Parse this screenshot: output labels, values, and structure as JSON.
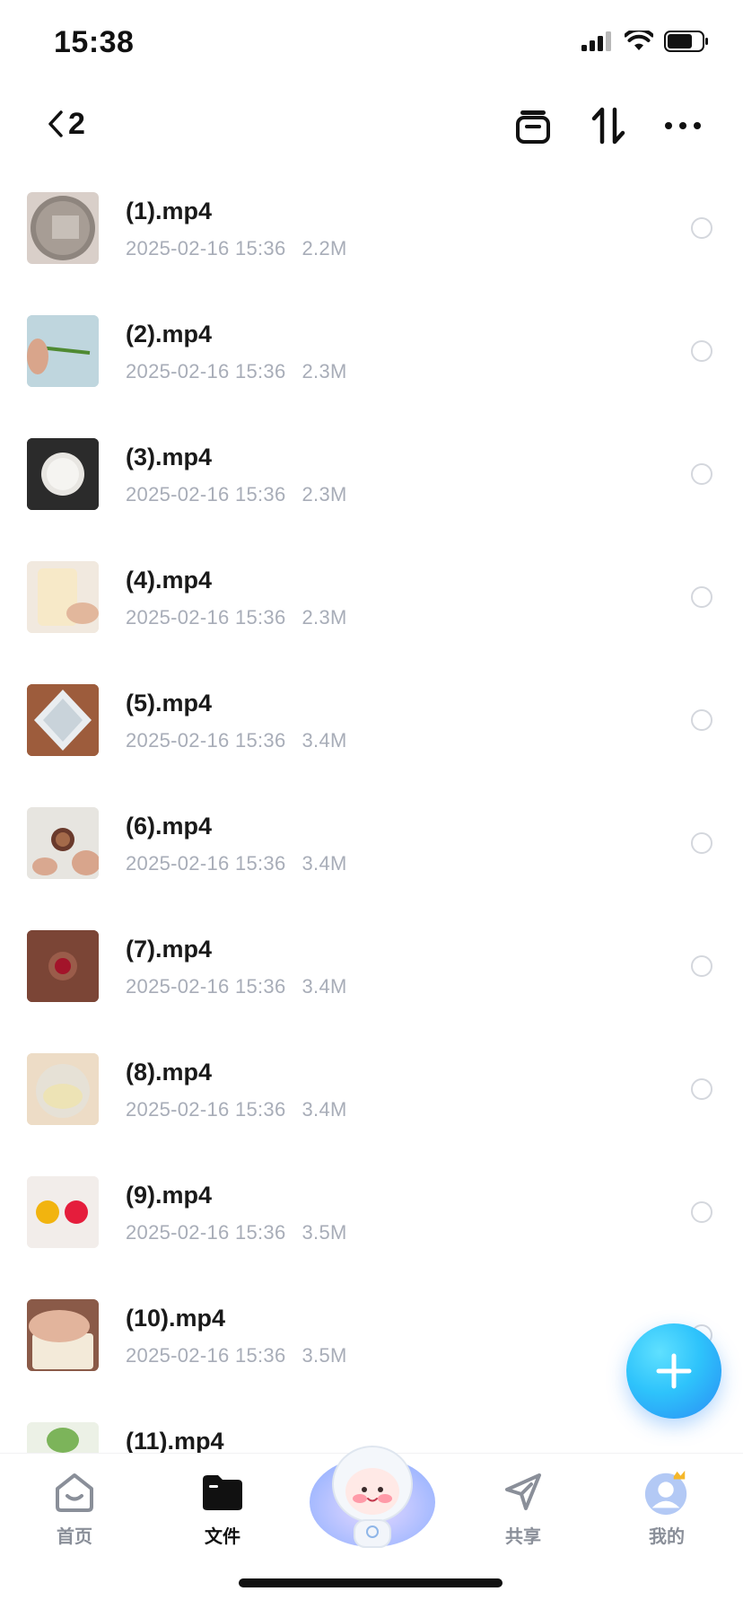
{
  "status_bar": {
    "time": "15:38"
  },
  "header": {
    "back_count": "2"
  },
  "files": [
    {
      "name": "(1).mp4",
      "date": "2025-02-16 15:36",
      "size": "2.2M"
    },
    {
      "name": "(2).mp4",
      "date": "2025-02-16 15:36",
      "size": "2.3M"
    },
    {
      "name": "(3).mp4",
      "date": "2025-02-16 15:36",
      "size": "2.3M"
    },
    {
      "name": "(4).mp4",
      "date": "2025-02-16 15:36",
      "size": "2.3M"
    },
    {
      "name": "(5).mp4",
      "date": "2025-02-16 15:36",
      "size": "3.4M"
    },
    {
      "name": "(6).mp4",
      "date": "2025-02-16 15:36",
      "size": "3.4M"
    },
    {
      "name": "(7).mp4",
      "date": "2025-02-16 15:36",
      "size": "3.4M"
    },
    {
      "name": "(8).mp4",
      "date": "2025-02-16 15:36",
      "size": "3.4M"
    },
    {
      "name": "(9).mp4",
      "date": "2025-02-16 15:36",
      "size": "3.5M"
    },
    {
      "name": "(10).mp4",
      "date": "2025-02-16 15:36",
      "size": "3.5M"
    },
    {
      "name": "(11).mp4"
    }
  ],
  "tab_bar": {
    "home": "首页",
    "files": "文件",
    "share": "共享",
    "mine": "我的"
  },
  "colors": {
    "accent": "#2ec3fb",
    "meta_text": "#a8adb8"
  }
}
